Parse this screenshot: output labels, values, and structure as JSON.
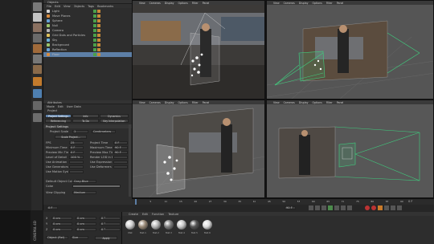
{
  "object_manager": {
    "title": "Objects",
    "menu": [
      "File",
      "Edit",
      "View",
      "Objects",
      "Tags",
      "Bookmarks"
    ],
    "objects": [
      {
        "name": "Light",
        "color": "#d6d6d6"
      },
      {
        "name": "Move Planes",
        "color": "#d98c3f"
      },
      {
        "name": "Sphere",
        "color": "#66a3d9"
      },
      {
        "name": "Null",
        "color": "#9ac46a"
      },
      {
        "name": "Camera",
        "color": "#b8b8b8"
      },
      {
        "name": "Grid Dots and Particles",
        "color": "#e0c15a"
      },
      {
        "name": "Sky",
        "color": "#6ab0d9"
      },
      {
        "name": "Background",
        "color": "#9ac46a"
      },
      {
        "name": "Reflection",
        "color": "#66a3d9"
      },
      {
        "name": "Floor",
        "color": "#d98c3f"
      }
    ]
  },
  "attributes": {
    "title": "Attributes",
    "menu": [
      "Mode",
      "Edit",
      "User Data"
    ],
    "section": "Project",
    "tabs_row1": [
      "Project Settings",
      "Info",
      "Dynamics"
    ],
    "tabs_row2": [
      "Referencing",
      "To Do",
      "Key Interpolation"
    ],
    "heading": "Project Settings",
    "scale_label": "Project Scale",
    "scale_value": "1",
    "scale_unit": "Centimeters",
    "scale_button": "Scale Project...",
    "left_fields": [
      {
        "label": "FPS",
        "value": "25"
      },
      {
        "label": "Minimum Time",
        "value": "0 F"
      },
      {
        "label": "Preview Min Time",
        "value": "0 F"
      },
      {
        "label": "Level of Detail",
        "value": "100 %"
      },
      {
        "label": "Use Animation",
        "value": ""
      },
      {
        "label": "Use Generators",
        "value": ""
      },
      {
        "label": "Use Motion System",
        "value": ""
      }
    ],
    "right_fields": [
      {
        "label": "Project Time",
        "value": "0 F"
      },
      {
        "label": "Maximum Time",
        "value": "90 F"
      },
      {
        "label": "Preview Max Time",
        "value": "90 F"
      },
      {
        "label": "Render LOD in Editor",
        "value": ""
      },
      {
        "label": "Use Expression",
        "value": ""
      },
      {
        "label": "Use Deformers",
        "value": ""
      }
    ],
    "default_color_label": "Default Object Color",
    "default_color_value": "Gray-Blue",
    "color_label": "Color",
    "view_clipping_label": "View Clipping",
    "view_clipping_value": "Medium"
  },
  "viewports": [
    {
      "name": "Perspective",
      "menu": [
        "View",
        "Cameras",
        "Display",
        "Options",
        "Filter",
        "Panel"
      ]
    },
    {
      "name": "Perspective",
      "menu": [
        "View",
        "Cameras",
        "Display",
        "Options",
        "Filter",
        "Panel"
      ]
    },
    {
      "name": "Perspective",
      "menu": [
        "View",
        "Cameras",
        "Display",
        "Options",
        "Filter",
        "Panel"
      ]
    },
    {
      "name": "Perspective",
      "menu": [
        "View",
        "Cameras",
        "Display",
        "Options",
        "Filter",
        "Panel"
      ]
    }
  ],
  "timeline": {
    "ticks": [
      "0",
      "5",
      "10",
      "15",
      "20",
      "25",
      "30",
      "35",
      "40",
      "45",
      "50",
      "55",
      "60",
      "65",
      "70",
      "75",
      "80",
      "85",
      "90"
    ],
    "current_frame": "0 F",
    "start": "0 F",
    "end": "90 F",
    "end_field": "90 F"
  },
  "coordinates": {
    "rows": [
      {
        "axis": "X",
        "pos": "0 cm",
        "size": "0 cm",
        "rot": "0 °"
      },
      {
        "axis": "Y",
        "pos": "0 cm",
        "size": "0 cm",
        "rot": "0 °"
      },
      {
        "axis": "Z",
        "pos": "0 cm",
        "size": "0 cm",
        "rot": "0 °"
      }
    ],
    "mode": "Object (Rel)",
    "size_mode": "Size",
    "apply": "Apply"
  },
  "materials": {
    "menu": [
      "Create",
      "Edit",
      "Function",
      "Texture"
    ],
    "items": [
      {
        "name": "Mat",
        "color": "#d0d0d0"
      },
      {
        "name": "Mat.1",
        "color": "#9a8a78"
      },
      {
        "name": "Mat.2",
        "color": "#b8b8b8"
      },
      {
        "name": "Mat.3",
        "color": "#7f7f7f"
      },
      {
        "name": "Mat.4",
        "color": "#c9c9c9"
      },
      {
        "name": "Mat.5",
        "color": "#555555"
      },
      {
        "name": "Mat.6",
        "color": "#dcdcdc"
      }
    ]
  },
  "colors": {
    "selection": "#5d7fa6",
    "camera_frustum": "#3fd07f"
  },
  "brand": "CINEMA 4D"
}
